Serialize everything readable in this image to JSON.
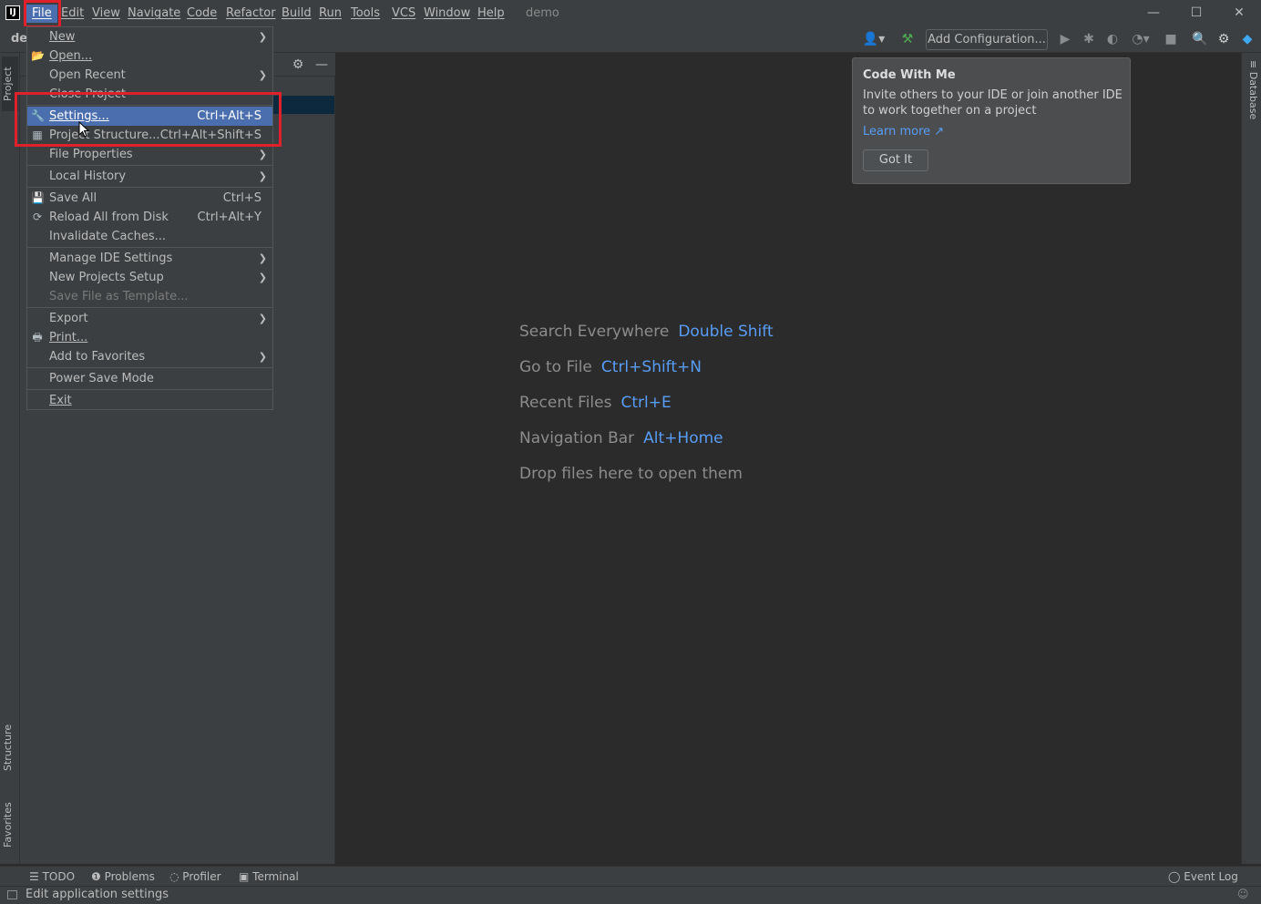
{
  "titlebar": {
    "logo": "IJ",
    "menus": [
      "File",
      "Edit",
      "View",
      "Navigate",
      "Code",
      "Refactor",
      "Build",
      "Run",
      "Tools",
      "VCS",
      "Window",
      "Help"
    ],
    "project_title": "demo",
    "window_controls": [
      "minimize-icon",
      "maximize-icon",
      "close-icon"
    ]
  },
  "navbar": {
    "breadcrumb": "de",
    "add_configuration": "Add Configuration..."
  },
  "side_tabs": {
    "project": "Project",
    "structure": "Structure",
    "favorites": "Favorites",
    "database": "Database"
  },
  "file_menu": {
    "items": [
      {
        "label": "New",
        "shortcut": "",
        "submenu": true
      },
      {
        "label": "Open...",
        "shortcut": "",
        "icon": "folder-open-icon"
      },
      {
        "label": "Open Recent",
        "shortcut": "",
        "submenu": true
      },
      {
        "label": "Close Project",
        "shortcut": ""
      },
      {
        "label": "Settings...",
        "shortcut": "Ctrl+Alt+S",
        "icon": "wrench-icon",
        "highlighted": true
      },
      {
        "label": "Project Structure...",
        "shortcut": "Ctrl+Alt+Shift+S",
        "icon": "project-structure-icon"
      },
      {
        "label": "File Properties",
        "shortcut": "",
        "submenu": true
      },
      {
        "label": "Local History",
        "shortcut": "",
        "submenu": true
      },
      {
        "label": "Save All",
        "shortcut": "Ctrl+S",
        "icon": "save-icon"
      },
      {
        "label": "Reload All from Disk",
        "shortcut": "Ctrl+Alt+Y",
        "icon": "reload-icon"
      },
      {
        "label": "Invalidate Caches...",
        "shortcut": ""
      },
      {
        "label": "Manage IDE Settings",
        "shortcut": "",
        "submenu": true
      },
      {
        "label": "New Projects Setup",
        "shortcut": "",
        "submenu": true
      },
      {
        "label": "Save File as Template...",
        "shortcut": "",
        "disabled": true
      },
      {
        "label": "Export",
        "shortcut": "",
        "submenu": true
      },
      {
        "label": "Print...",
        "shortcut": "",
        "icon": "print-icon"
      },
      {
        "label": "Add to Favorites",
        "shortcut": "",
        "submenu": true
      },
      {
        "label": "Power Save Mode",
        "shortcut": ""
      },
      {
        "label": "Exit",
        "shortcut": ""
      }
    ]
  },
  "editor_hints": [
    {
      "text": "Search Everywhere",
      "key": "Double Shift"
    },
    {
      "text": "Go to File",
      "key": "Ctrl+Shift+N"
    },
    {
      "text": "Recent Files",
      "key": "Ctrl+E"
    },
    {
      "text": "Navigation Bar",
      "key": "Alt+Home"
    },
    {
      "text": "Drop files here to open them",
      "key": ""
    }
  ],
  "popup": {
    "title": "Code With Me",
    "body": "Invite others to your IDE or join another IDE to work together on a project",
    "link": "Learn more ↗",
    "button": "Got It"
  },
  "bottom_tabs": [
    "TODO",
    "Problems",
    "Profiler",
    "Terminal"
  ],
  "event_log": "Event Log",
  "status": "Edit application settings",
  "colors": {
    "background": "#2b2b2b",
    "chrome": "#3c3f41",
    "selection": "#4b6eaf",
    "accent_link": "#589df6",
    "annotation_red": "#e0202a"
  }
}
